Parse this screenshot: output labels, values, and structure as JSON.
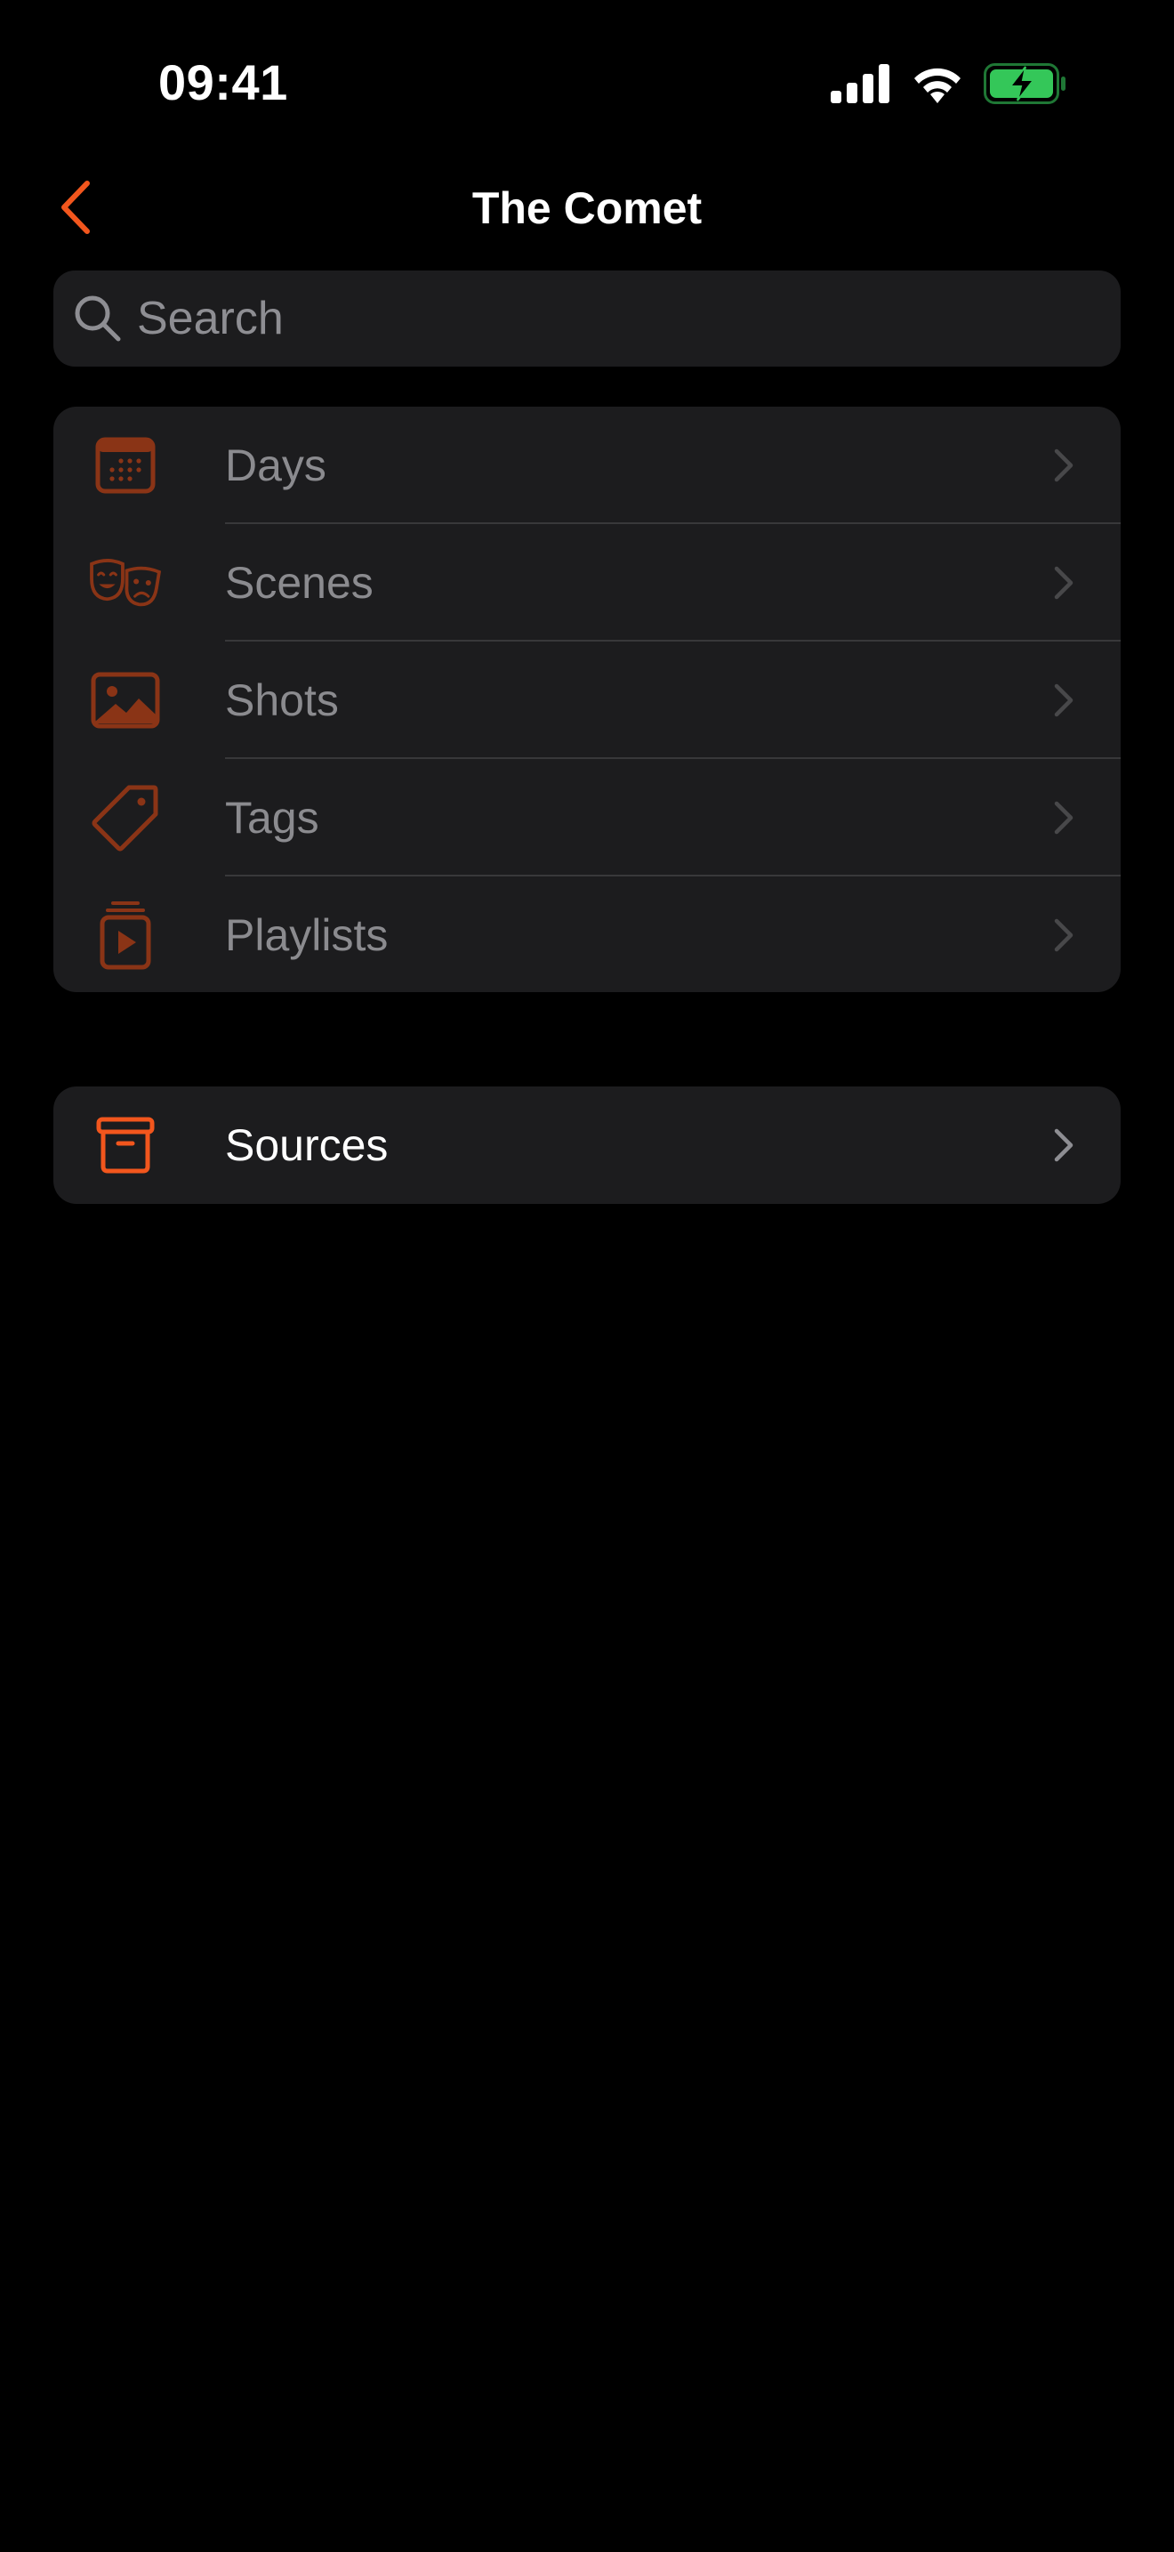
{
  "status_bar": {
    "time": "09:41",
    "icons": [
      "cellular-signal-icon",
      "wifi-icon",
      "battery-charging-icon"
    ],
    "battery_color": "#34c759"
  },
  "nav": {
    "title": "The Comet",
    "back_icon": "chevron-left-icon"
  },
  "search": {
    "placeholder": "Search",
    "value": ""
  },
  "colors": {
    "accent": "#f2561d",
    "accent_dim": "#8a3416",
    "background": "#000000",
    "group_background": "#1c1c1e",
    "disabled_text": "#8b8b8f"
  },
  "library": {
    "items": [
      {
        "label": "Days",
        "icon": "calendar-icon"
      },
      {
        "label": "Scenes",
        "icon": "theater-masks-icon"
      },
      {
        "label": "Shots",
        "icon": "photo-icon"
      },
      {
        "label": "Tags",
        "icon": "tag-icon"
      },
      {
        "label": "Playlists",
        "icon": "playlist-icon"
      }
    ]
  },
  "sources": {
    "label": "Sources",
    "icon": "archive-box-icon"
  }
}
